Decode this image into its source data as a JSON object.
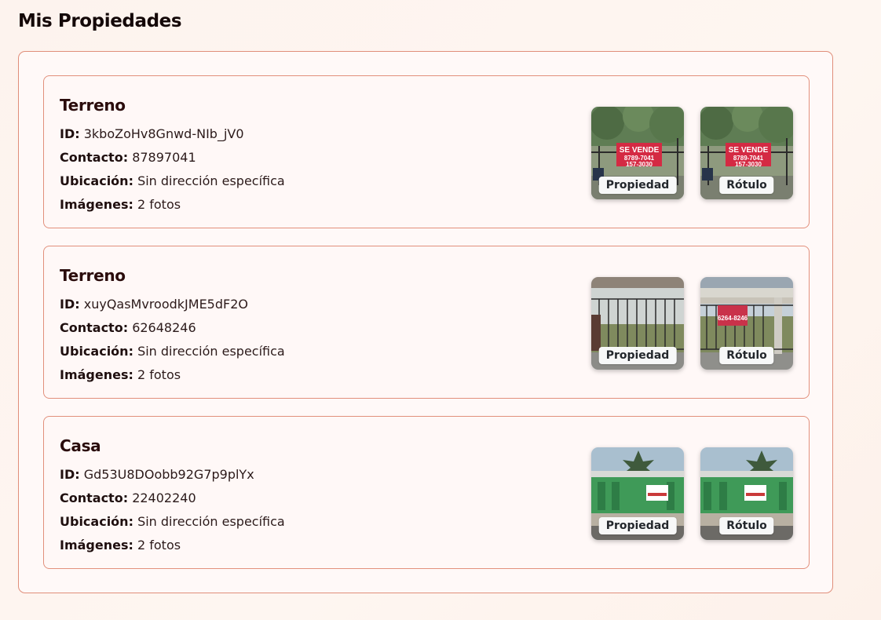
{
  "page_title": "Mis Propiedades",
  "labels": {
    "id": "ID:",
    "contact": "Contacto:",
    "location": "Ubicación:",
    "images": "Imágenes:"
  },
  "properties": [
    {
      "type": "Terreno",
      "id": "3kboZoHv8Gnwd-NIb_jV0",
      "contact": "87897041",
      "location": "Sin dirección específica",
      "images": "2 fotos",
      "thumbs": [
        {
          "label": "Propiedad",
          "sign_text": "SE VENDE",
          "sign_lines": [
            "8789-7041",
            "157-3030"
          ]
        },
        {
          "label": "Rótulo",
          "sign_text": "SE VENDE",
          "sign_lines": [
            "8789-7041",
            "157-3030"
          ]
        }
      ]
    },
    {
      "type": "Terreno",
      "id": "xuyQasMvroodkJME5dF2O",
      "contact": "62648246",
      "location": "Sin dirección específica",
      "images": "2 fotos",
      "thumbs": [
        {
          "label": "Propiedad"
        },
        {
          "label": "Rótulo",
          "sign_lines": [
            "6264-8246"
          ]
        }
      ]
    },
    {
      "type": "Casa",
      "id": "Gd53U8DOobb92G7p9plYx",
      "contact": "22402240",
      "location": "Sin dirección específica",
      "images": "2 fotos",
      "thumbs": [
        {
          "label": "Propiedad"
        },
        {
          "label": "Rótulo"
        }
      ]
    }
  ]
}
